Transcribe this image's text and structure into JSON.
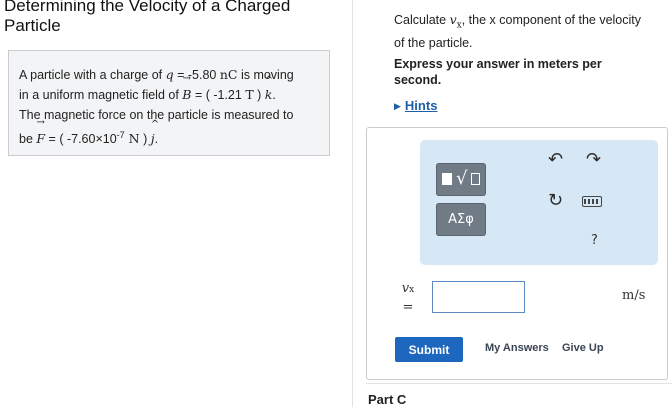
{
  "problem": {
    "title_line1": "Determining the Velocity of a Charged",
    "title_line2": "Particle",
    "line1_pre": "A particle with a charge of ",
    "q_symbol": "q",
    "line1_eq": " = -5.80 ",
    "line1_unit": "nC",
    "line1_post": " is moving",
    "line2_pre": "in a uniform magnetic field of ",
    "B_symbol": "B",
    "line2_eq": " = ( -1.21 ",
    "line2_unit": "T",
    "line2_close": " ) ",
    "k_symbol": "k",
    "line2_end": ".",
    "line3": "The magnetic force on the particle is measured to",
    "line4_pre": "be ",
    "F_symbol": "F",
    "line4_eq": " = ( -7.60×10",
    "line4_exp": "-7",
    "line4_unit": " N",
    "line4_close": " ) ",
    "j_symbol": "j",
    "line4_end": "."
  },
  "question": {
    "pre": "Calculate ",
    "var": "v",
    "var_sub": "x",
    "post": ", the x component of the velocity of the particle."
  },
  "instruction": "Express your answer in meters per second.",
  "hints": {
    "label": "Hints",
    "icon": "triangle-right-icon"
  },
  "toolbar": {
    "greek_label": "ΑΣφ",
    "undo_glyph": "↶",
    "redo_glyph": "↷",
    "reset_glyph": "↻",
    "help_glyph": "?"
  },
  "answer": {
    "var": "v",
    "var_sub": "x",
    "equals": "=",
    "value": "",
    "unit": "m/s"
  },
  "actions": {
    "submit": "Submit",
    "my_answers": "My Answers",
    "give_up": "Give Up"
  },
  "next_part": "Part C",
  "colors": {
    "link": "#1d5fa7",
    "submit_bg": "#1e67be",
    "toolbar_bg": "#d6e7f5",
    "problem_bg": "#f3f4f6"
  }
}
